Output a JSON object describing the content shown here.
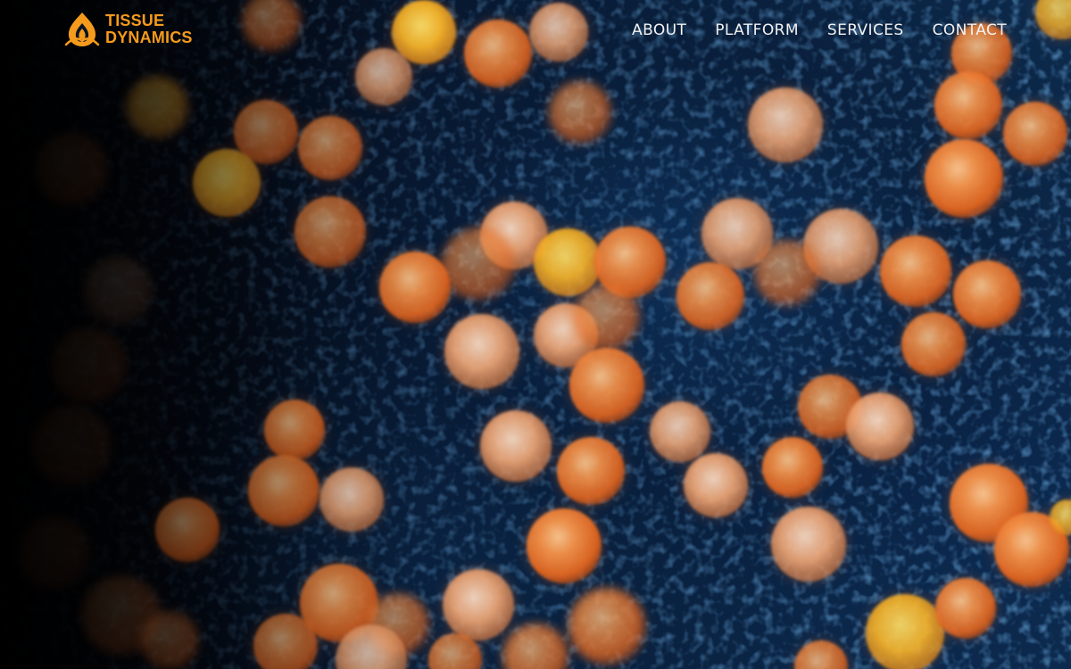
{
  "brand": {
    "line1": "TISSUE",
    "line2": "DYNAMICS",
    "logo_icon": "flame-cell-logo-icon",
    "accent_color": "#f59a1b"
  },
  "nav": {
    "items": [
      {
        "label": "ABOUT"
      },
      {
        "label": "PLATFORM"
      },
      {
        "label": "SERVICES"
      },
      {
        "label": "CONTACT"
      }
    ]
  },
  "hero": {
    "background_image": "microscopy-cells-orange-on-blue",
    "cell_color": "#f07a2a",
    "background_color": "#0c2a4c"
  }
}
